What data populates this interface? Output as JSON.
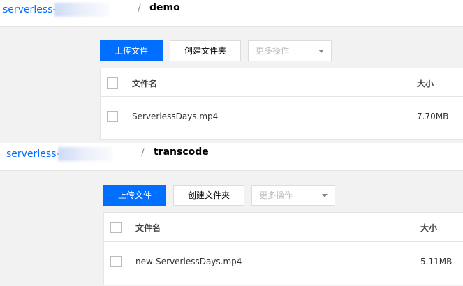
{
  "panels": [
    {
      "breadcrumb": {
        "bucket": "serverless-",
        "bucket_masked": "days",
        "separator": "/",
        "directory": "demo"
      },
      "toolbar": {
        "upload_label": "上传文件",
        "create_folder_label": "创建文件夹",
        "more_actions_label": "更多操作"
      },
      "table": {
        "columns": {
          "name": "文件名",
          "size": "大小"
        },
        "rows": [
          {
            "name": "ServerlessDays.mp4",
            "size": "7.70MB"
          }
        ]
      }
    },
    {
      "breadcrumb": {
        "bucket": "serverless-",
        "bucket_masked": "days",
        "separator": "/",
        "directory": "transcode"
      },
      "toolbar": {
        "upload_label": "上传文件",
        "create_folder_label": "创建文件夹",
        "more_actions_label": "更多操作"
      },
      "table": {
        "columns": {
          "name": "文件名",
          "size": "大小"
        },
        "rows": [
          {
            "name": "new-ServerlessDays.mp4",
            "size": "5.11MB"
          }
        ]
      }
    }
  ],
  "colors": {
    "accent": "#006eff",
    "background": "#f2f2f2",
    "border": "#e5e5e5"
  }
}
